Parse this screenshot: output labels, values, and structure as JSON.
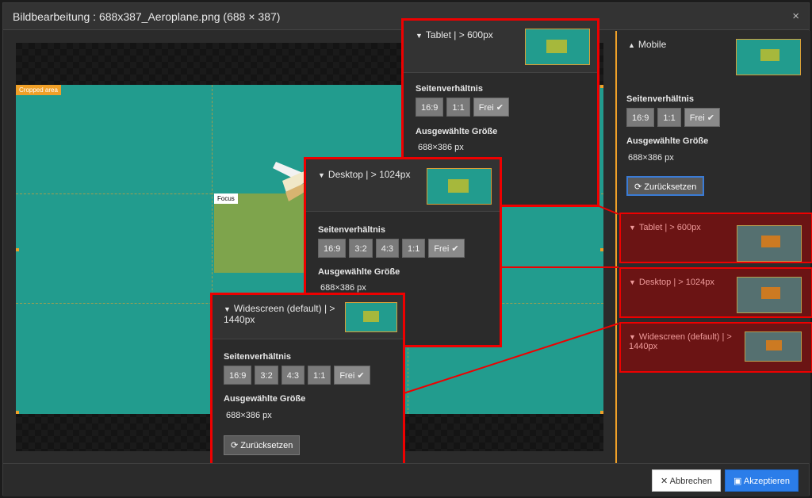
{
  "window": {
    "title": "Bildbearbeitung : 688x387_Aeroplane.png (688 × 387)",
    "close": "×"
  },
  "canvas": {
    "cropped_label": "Cropped area",
    "focus_label": "Focus"
  },
  "sidebar": {
    "mobile": {
      "title": "Mobile",
      "aspect_label": "Seitenverhältnis",
      "ratios": [
        "16:9",
        "1:1"
      ],
      "free_label": "Frei",
      "size_label": "Ausgewählte Größe",
      "size_value": "688×386 px",
      "reset_label": "Zurücksetzen"
    },
    "items": [
      {
        "title": "Tablet | > 600px"
      },
      {
        "title": "Desktop | > 1024px"
      },
      {
        "title": "Widescreen (default) | > 1440px"
      }
    ]
  },
  "popups": {
    "tablet": {
      "title": "Tablet | > 600px",
      "aspect_label": "Seitenverhältnis",
      "ratios": [
        "16:9",
        "1:1"
      ],
      "free_label": "Frei",
      "size_label": "Ausgewählte Größe",
      "size_value": "688×386 px"
    },
    "desktop": {
      "title": "Desktop | > 1024px",
      "aspect_label": "Seitenverhältnis",
      "ratios": [
        "16:9",
        "3:2",
        "4:3",
        "1:1"
      ],
      "free_label": "Frei",
      "size_label": "Ausgewählte Größe",
      "size_value": "688×386 px"
    },
    "widescreen": {
      "title_line1": "Widescreen (default) | >",
      "title_line2": "1440px",
      "aspect_label": "Seitenverhältnis",
      "ratios": [
        "16:9",
        "3:2",
        "4:3",
        "1:1"
      ],
      "free_label": "Frei",
      "size_label": "Ausgewählte Größe",
      "size_value": "688×386 px",
      "reset_label": "Zurücksetzen"
    }
  },
  "footer": {
    "cancel_label": "Abbrechen",
    "accept_label": "Akzeptieren"
  },
  "colors": {
    "accent": "#f0a028",
    "highlight": "#e00000",
    "primary": "#2b7de9",
    "teal": "#229c8e"
  }
}
